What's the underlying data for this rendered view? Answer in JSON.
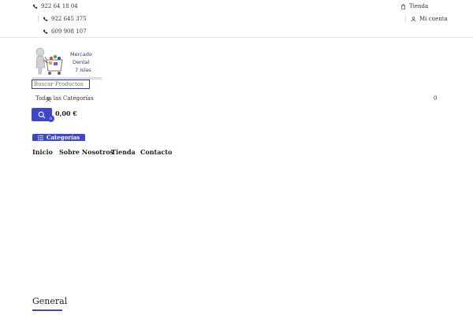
{
  "topbar": {
    "phones": [
      "922 64 18 04",
      "922 645 375",
      "609 908 107"
    ],
    "shop_label": "Tienda",
    "account_label": "Mi cuenta"
  },
  "logo": {
    "line1": "Mercado",
    "line2": "Dental",
    "line3": "7 Islas"
  },
  "search": {
    "placeholder": "Buscar Productos",
    "category_label": "Todas las Categorías",
    "category_count": "0"
  },
  "cart": {
    "count": "0",
    "total": "0,00 €"
  },
  "categories_button": "Categorías",
  "nav": [
    "Inicio",
    "Sobre Nosotros",
    "Tienda",
    "Contacto"
  ],
  "section": {
    "title": "General"
  },
  "colors": {
    "accent": "#3d47c9"
  }
}
